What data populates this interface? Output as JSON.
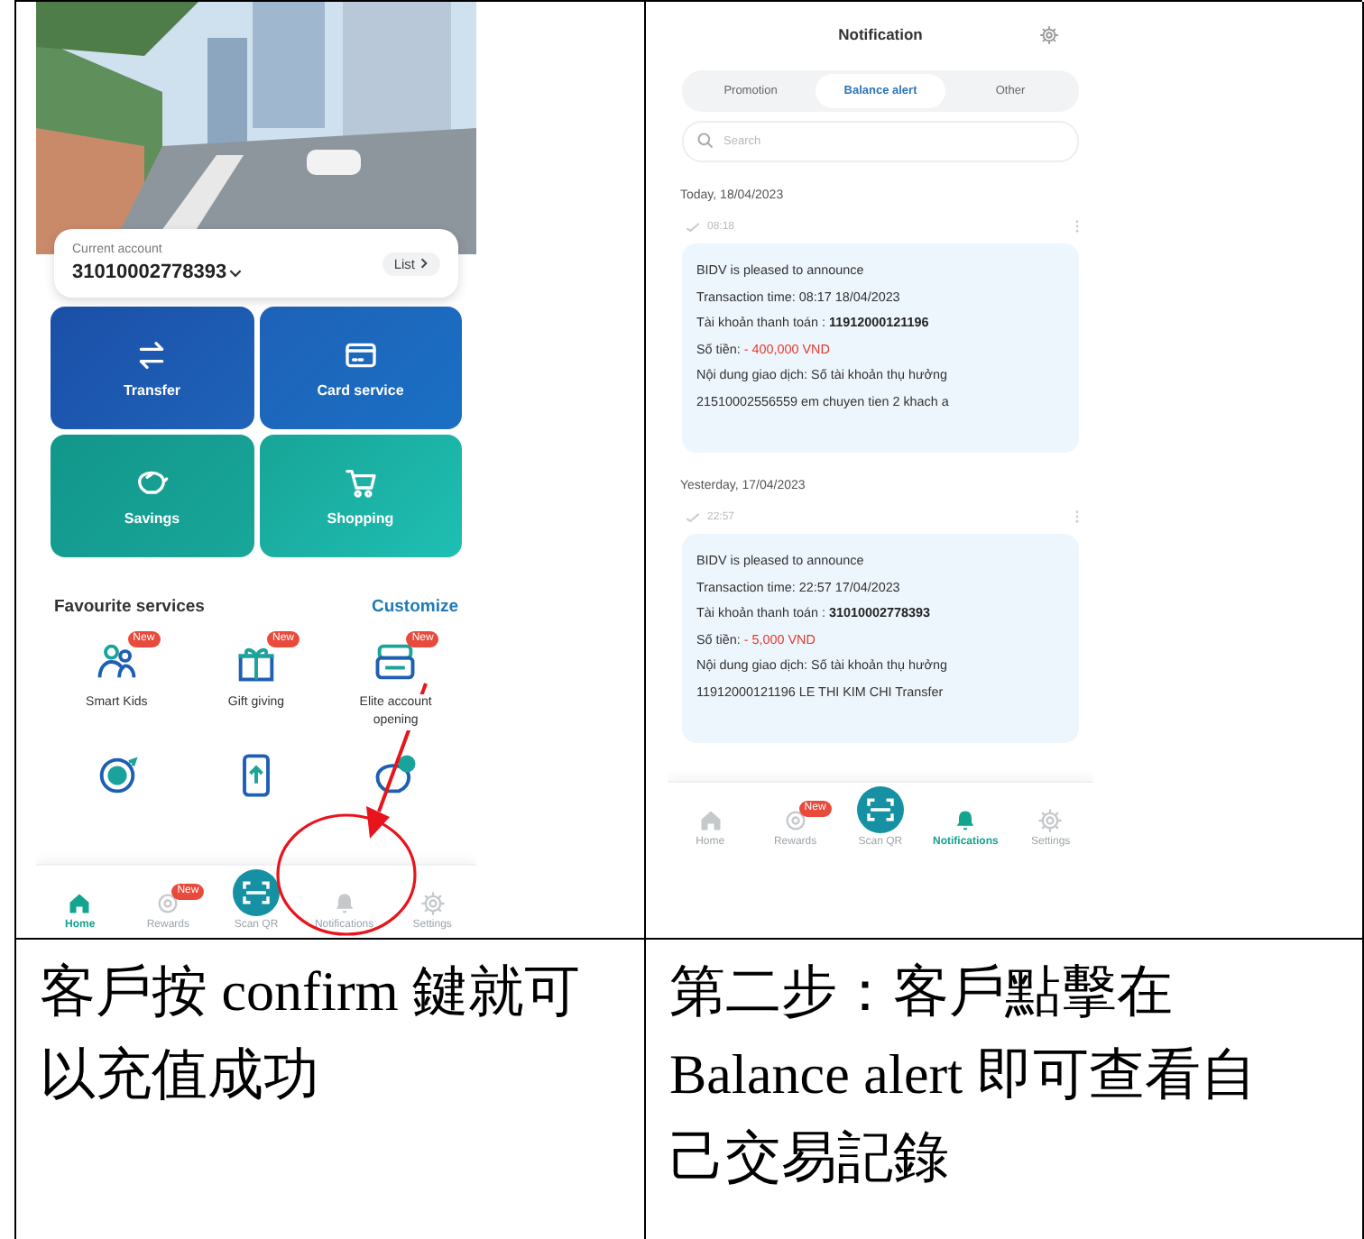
{
  "home_screen": {
    "account": {
      "label": "Current account",
      "number": "31010002778393",
      "list_label": "List"
    },
    "tiles": [
      {
        "label": "Transfer",
        "kind": "transfer"
      },
      {
        "label": "Card service",
        "kind": "card"
      },
      {
        "label": "Savings",
        "kind": "savings"
      },
      {
        "label": "Shopping",
        "kind": "cart"
      }
    ],
    "favourites": {
      "title": "Favourite services",
      "action": "Customize",
      "items": [
        {
          "label": "Smart Kids",
          "badge": "New",
          "kind": "kids"
        },
        {
          "label": "Gift giving",
          "badge": "New",
          "kind": "gift"
        },
        {
          "label": "Elite account opening",
          "badge": "New",
          "kind": "elite"
        },
        {
          "kind": "coin"
        },
        {
          "kind": "phone"
        },
        {
          "kind": "piggy"
        }
      ]
    },
    "nav": [
      {
        "label": "Home",
        "kind": "home",
        "selected": true
      },
      {
        "label": "Rewards",
        "kind": "rewards",
        "badge": "New",
        "selected": false
      },
      {
        "label": "Scan QR",
        "kind": "scan",
        "selected": false
      },
      {
        "label": "Notifications",
        "kind": "bell",
        "selected": false
      },
      {
        "label": "Settings",
        "kind": "gear",
        "selected": false
      }
    ],
    "annotation": {
      "arrow": true,
      "circle": true
    }
  },
  "notification_screen": {
    "title": "Notification",
    "tabs": [
      {
        "label": "Promotion",
        "selected": false
      },
      {
        "label": "Balance alert",
        "selected": true
      },
      {
        "label": "Other",
        "selected": false
      }
    ],
    "search": {
      "placeholder": "Search"
    },
    "groups": [
      {
        "date": "Today, 18/04/2023",
        "time": "08:18",
        "message": {
          "intro": "BIDV is pleased to announce",
          "time_line": "Transaction time: 08:17 18/04/2023",
          "account_line": "Tài khoản thanh toán : **11912000121196**",
          "amount_label": "Số tiền:",
          "amount": "- 400,000 VND",
          "content": "Nội dung giao dịch: Số tài khoản thụ hưởng 21510002556559 em chuyen tien 2 khach a"
        }
      },
      {
        "date": "Yesterday, 17/04/2023",
        "time": "22:57",
        "message": {
          "intro": "BIDV is pleased to announce",
          "time_line": "Transaction time: 22:57 17/04/2023",
          "account_line": "Tài khoản thanh toán : **31010002778393**",
          "amount_label": "Số tiền:",
          "amount": "- 5,000 VND",
          "content": "Nội dung giao dịch: Số tài khoản thụ hưởng 11912000121196 LE THI KIM CHI Transfer"
        }
      }
    ],
    "nav": [
      {
        "label": "Home",
        "kind": "home",
        "selected": false
      },
      {
        "label": "Rewards",
        "kind": "rewards",
        "badge": "New",
        "selected": false
      },
      {
        "label": "Scan QR",
        "kind": "scan",
        "selected": false
      },
      {
        "label": "Notifications",
        "kind": "bell",
        "selected": true
      },
      {
        "label": "Settings",
        "kind": "gear",
        "selected": false
      }
    ]
  },
  "captions": [
    "客戶按 confirm 鍵就可以充值成功",
    "第二步：客戶點擊在 Balance alert 即可查看自己交易記錄"
  ]
}
